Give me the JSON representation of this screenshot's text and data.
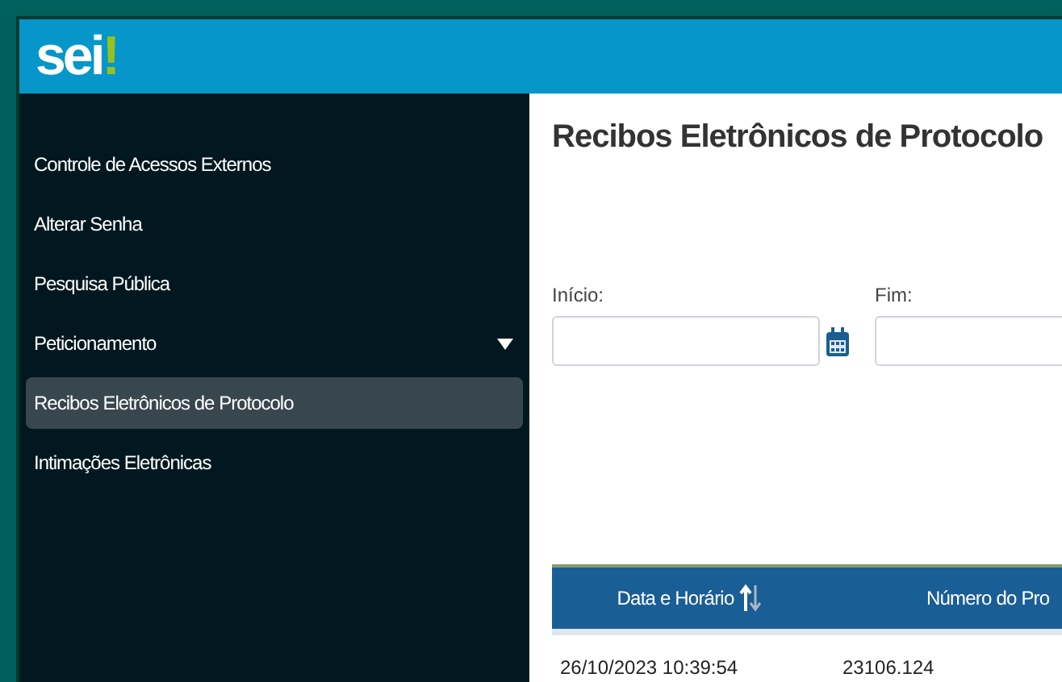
{
  "logo": {
    "text": "sei",
    "mark": "!"
  },
  "sidebar": {
    "items": [
      {
        "label": "Controle de Acessos Externos",
        "kind": "link",
        "selected": false
      },
      {
        "label": "Alterar Senha",
        "kind": "link",
        "selected": false
      },
      {
        "label": "Pesquisa Pública",
        "kind": "link",
        "selected": false
      },
      {
        "label": "Peticionamento",
        "kind": "group",
        "expanded": false,
        "selected": false
      },
      {
        "label": "Recibos Eletrônicos de Protocolo",
        "kind": "link",
        "selected": true
      },
      {
        "label": "Intimações Eletrônicas",
        "kind": "link",
        "selected": false
      }
    ]
  },
  "page_title": "Recibos Eletrônicos de Protocolo",
  "filters": [
    {
      "label": "Início:",
      "kind": "date"
    },
    {
      "label": "Fim:",
      "kind": "date"
    }
  ],
  "table": {
    "columns": [
      {
        "label": "Data e Horário",
        "sortable": true
      },
      {
        "label": "Número do Pro",
        "sortable": false
      }
    ],
    "rows": [
      [
        "26/10/2023 10:39:54",
        "23106.124"
      ]
    ]
  }
}
